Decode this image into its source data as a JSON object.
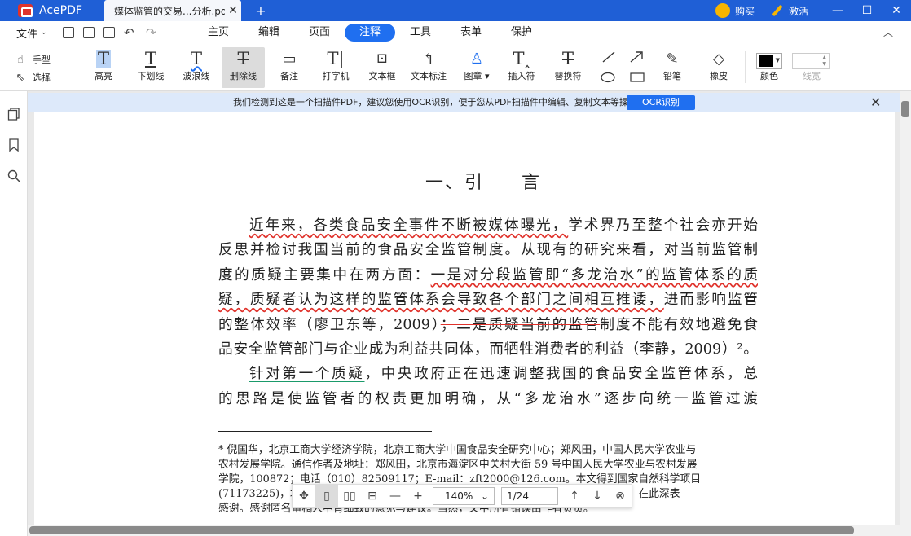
{
  "titlebar": {
    "app_name": "AcePDF",
    "doc_tab": "媒体监管的交易...分析.pdf*",
    "close_glyph": "✕",
    "new_tab_glyph": "+",
    "buy": "购买",
    "activate": "激活",
    "minimize_glyph": "—",
    "maximize_glyph": "☐",
    "close_window_glyph": "✕"
  },
  "menubar": {
    "file": "文件",
    "tabs": [
      "主页",
      "编辑",
      "页面",
      "注释",
      "工具",
      "表单",
      "保护"
    ],
    "active_tab": "注释",
    "collapse_glyph": "︿"
  },
  "ribbon": {
    "hand": "手型",
    "select": "选择",
    "tools": {
      "highlight": "高亮",
      "underline": "下划线",
      "squiggly": "波浪线",
      "strikethrough": "删除线",
      "note": "备注",
      "typewriter": "打字机",
      "textbox": "文本框",
      "callout": "文本标注",
      "stamp": "图章",
      "insert": "插入符",
      "replace": "替换符",
      "pencil": "铅笔",
      "eraser": "橡皮",
      "color": "颜色",
      "line_width": "线宽"
    },
    "active_tool": "strikethrough",
    "current_color": "#000000"
  },
  "ocr_banner": {
    "message": "我们检测到这是一个扫描件PDF，建议您使用OCR识别，便于您从PDF扫描件中编辑、复制文本等操作。",
    "button": "OCR识别",
    "close_glyph": "✕"
  },
  "document": {
    "heading_left": "一、引",
    "heading_right": "言",
    "p1_l1_a": "近年来，各类食品安全事件不断被媒体曝光，",
    "p1_l1_b": "学术界乃至整个社会亦开始",
    "p1_l2": "反思并检讨我国当前的食品安全监管制度。从现有的研究来看，对当前监管制",
    "p1_l3_a": "度的质疑主要集中在两方面：",
    "p1_l3_b": "一是对分段监管即“多龙治水”的监管体系的质",
    "p1_l4_a": "疑，质疑者认为这样的监管体系会导致各个部门之间相互推诿，",
    "p1_l4_b": "进而影响监管",
    "p1_l5_a": "的整体效率（廖卫东等，2009）",
    "p1_l5_b": "；二是质疑当前的监管",
    "p1_l5_c": "制度不能有效地避免食",
    "p1_l6": "品安全监管部门与企业成为利益共同体，而牺牲消费者的利益（李静，2009）²。",
    "p2_l1_a": "针对第一个质疑",
    "p2_l1_b": "，中央政府正在迅速调整我国的食品安全监管体系，总",
    "p2_l2": "的思路是使监管者的权责更加明确，从“多龙治水”逐步向统一监管过渡",
    "footnote": [
      "* 倪国华，北京工商大学经济学院，北京工商大学中国食品安全研究中心；郑风田，中国人民大学农业与",
      "农村发展学院。通信作者及地址：郑风田，北京市海淀区中关村大街 59 号中国人民大学农业与农村发展",
      "学院，100872；电话（010）82509117；E-mail：zft2000@126.com。本文得到国家自然科学项目",
      "(71173225)，北京市哲学社会科学规划项目和国家社会科学基金（12AZD031）的资助，在此深表",
      "感谢。感谢匿名审稿人中肯细致的意见与建议。当然，文中所有错误由作者负责。"
    ]
  },
  "float_toolbar": {
    "zoom": "140%",
    "page": "1/24"
  }
}
